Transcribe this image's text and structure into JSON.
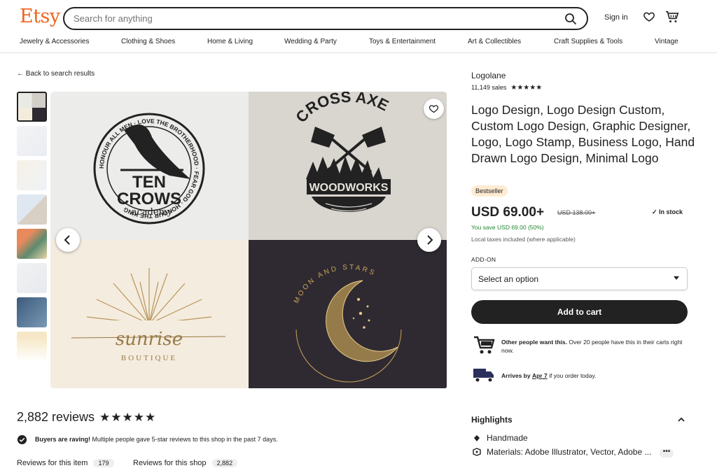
{
  "header": {
    "logo": "Etsy",
    "search_placeholder": "Search for anything",
    "signin": "Sign in"
  },
  "categories": [
    "Jewelry & Accessories",
    "Clothing & Shoes",
    "Home & Living",
    "Wedding & Party",
    "Toys & Entertainment",
    "Art & Collectibles",
    "Craft Supplies & Tools",
    "Vintage"
  ],
  "nav": {
    "back": "Back to search results"
  },
  "gallery": {
    "images": [
      {
        "name": "ten-crows-logo",
        "lines": [
          "TEN",
          "CROWS",
          "academy"
        ],
        "ring_text": "HONOUR ALL MEN · LOVE THE BROTHERHOOD · FEAR GOD · HONOUR THE KING"
      },
      {
        "name": "cross-axe-logo",
        "lines": [
          "CROSS AXE",
          "WOODWORKS"
        ]
      },
      {
        "name": "sunrise-logo",
        "lines": [
          "sunrise",
          "BOUTIQUE"
        ]
      },
      {
        "name": "moon-stars-logo",
        "lines": [
          "MOON AND STARS"
        ]
      }
    ]
  },
  "product": {
    "shop_name": "Logolane",
    "sales": "11,149 sales",
    "shop_stars": "★★★★★",
    "title": "Logo Design, Logo Design Custom, Custom Logo Design, Graphic Designer, Logo, Logo Stamp, Business Logo, Hand Drawn Logo Design, Minimal Logo",
    "badge": "Bestseller",
    "price": "USD 69.00+",
    "old_price": "USD 138.00+",
    "stock": "In stock",
    "savings": "You save USD 69.00 (50%)",
    "tax_note": "Local taxes included (where applicable)",
    "addon_label": "ADD-ON",
    "select_value": "Select an option",
    "add_to_cart": "Add to cart",
    "demand_bold": "Other people want this.",
    "demand_text": " Over 20 people have this in their carts right now.",
    "arrives_bold": "Arrives by",
    "arrives_date": "Apr 7",
    "arrives_text": " if you order today."
  },
  "reviews": {
    "count": "2,882 reviews",
    "stars": "★★★★★",
    "raving_bold": "Buyers are raving!",
    "raving_text": " Multiple people gave 5-star reviews to this shop in the past 7 days.",
    "tab_item": "Reviews for this item",
    "tab_item_count": "179",
    "tab_shop": "Reviews for this shop",
    "tab_shop_count": "2,882"
  },
  "highlights": {
    "title": "Highlights",
    "items": [
      "Handmade",
      "Materials: Adobe Illustrator, Vector, Adobe ..."
    ]
  },
  "colors": {
    "brand": "#f1641e",
    "accent_green": "#258635",
    "button": "#222222",
    "badge_bg": "#fdebd2"
  }
}
